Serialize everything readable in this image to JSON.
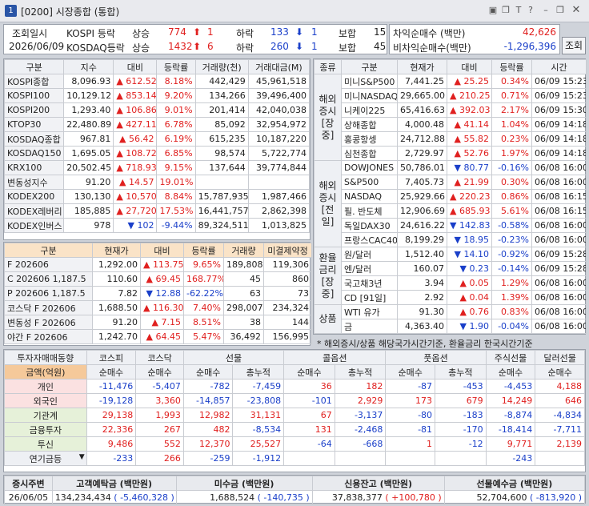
{
  "window": {
    "number": "1",
    "title": "[0200] 시장종합 (통합)"
  },
  "query": {
    "label": "조회일시",
    "date": "2026/06/09",
    "button": "조회"
  },
  "breadth": [
    {
      "market": "KOSPI 등락",
      "up_label": "상승",
      "up": "774",
      "limit_up": "1",
      "down_label": "하락",
      "down": "133",
      "limit_down": "1",
      "flat_label": "보합",
      "flat": "15"
    },
    {
      "market": "KOSDAQ등락",
      "up_label": "상승",
      "up": "1432",
      "limit_up": "6",
      "down_label": "하락",
      "down": "260",
      "limit_down": "1",
      "flat_label": "보합",
      "flat": "45"
    }
  ],
  "arb": [
    {
      "label": "차익순매수 (백만)",
      "value": "42,626"
    },
    {
      "label": "비차익순매수(백만)",
      "value": "-1,296,396"
    }
  ],
  "index_table": {
    "headers": [
      "구분",
      "지수",
      "대비",
      "등락률",
      "거래량(천)",
      "거래대금(M)"
    ],
    "rows": [
      {
        "name": "KOSPI종합",
        "v": "8,096.93",
        "chg": "612.52",
        "dir": "up",
        "rate": "8.18%",
        "vol": "442,429",
        "amt": "45,961,518"
      },
      {
        "name": "KOSPI100",
        "v": "10,129.12",
        "chg": "853.14",
        "dir": "up",
        "rate": "9.20%",
        "vol": "134,266",
        "amt": "39,496,400"
      },
      {
        "name": "KOSPI200",
        "v": "1,293.40",
        "chg": "106.86",
        "dir": "up",
        "rate": "9.01%",
        "vol": "201,414",
        "amt": "42,040,038"
      },
      {
        "name": "KTOP30",
        "v": "22,480.89",
        "chg": "427.11",
        "dir": "up",
        "rate": "6.78%",
        "vol": "85,092",
        "amt": "32,954,972"
      },
      {
        "name": "KOSDAQ종합",
        "v": "967.81",
        "chg": "56.42",
        "dir": "up",
        "rate": "6.19%",
        "vol": "615,235",
        "amt": "10,187,220"
      },
      {
        "name": "KOSDAQ150",
        "v": "1,695.05",
        "chg": "108.72",
        "dir": "up",
        "rate": "6.85%",
        "vol": "98,574",
        "amt": "5,722,774"
      },
      {
        "name": "KRX100",
        "v": "20,502.45",
        "chg": "718.93",
        "dir": "up",
        "rate": "9.15%",
        "vol": "137,644",
        "amt": "39,774,844"
      },
      {
        "name": "변동성지수",
        "v": "91.20",
        "chg": "14.57",
        "dir": "up",
        "rate": "19.01%",
        "vol": "",
        "amt": ""
      },
      {
        "name": "KODEX200",
        "v": "130,130",
        "chg": "10,570",
        "dir": "up",
        "rate": "8.84%",
        "vol": "15,787,935",
        "amt": "1,987,466"
      },
      {
        "name": "KODEX레버리",
        "v": "185,885",
        "chg": "27,720",
        "dir": "up",
        "rate": "17.53%",
        "vol": "16,441,757",
        "amt": "2,862,398"
      },
      {
        "name": "KODEX인버스",
        "v": "978",
        "chg": "102",
        "dir": "dn",
        "rate": "-9.44%",
        "vol": "89,324,511",
        "amt": "1,013,825"
      }
    ]
  },
  "futures_table": {
    "headers": [
      "구분",
      "현재가",
      "대비",
      "등락률",
      "거래량",
      "미결제약정"
    ],
    "rows": [
      {
        "name": "F 202606",
        "v": "1,292.00",
        "chg": "113.75",
        "dir": "up",
        "rate": "9.65%",
        "vol": "189,808",
        "oi": "119,306"
      },
      {
        "name": "C 202606 1,187.5",
        "v": "110.60",
        "chg": "69.45",
        "dir": "up",
        "rate": "168.77%",
        "vol": "45",
        "oi": "860"
      },
      {
        "name": "P 202606 1,187.5",
        "v": "7.82",
        "chg": "12.88",
        "dir": "dn",
        "rate": "-62.22%",
        "vol": "63",
        "oi": "73"
      },
      {
        "name": "코스닥 F 202606",
        "v": "1,688.50",
        "chg": "116.30",
        "dir": "up",
        "rate": "7.40%",
        "vol": "298,007",
        "oi": "234,324"
      },
      {
        "name": "변동성 F 202606",
        "v": "91.20",
        "chg": "7.15",
        "dir": "up",
        "rate": "8.51%",
        "vol": "38",
        "oi": "144"
      },
      {
        "name": "야간 F 202606",
        "v": "1,242.70",
        "chg": "64.45",
        "dir": "up",
        "rate": "5.47%",
        "vol": "36,492",
        "oi": "156,995"
      }
    ]
  },
  "overseas_table": {
    "headers": [
      "종류",
      "구분",
      "현재가",
      "대비",
      "등락률",
      "시간"
    ],
    "groups": [
      {
        "label": "해외\n증시\n[장중]",
        "rows": [
          {
            "name": "미니S&P500",
            "v": "7,441.25",
            "chg": "25.25",
            "dir": "up",
            "rate": "0.34%",
            "time": "06/09 15:23"
          },
          {
            "name": "미니NASDAQ",
            "v": "29,665.00",
            "chg": "210.25",
            "dir": "up",
            "rate": "0.71%",
            "time": "06/09 15:23"
          },
          {
            "name": "니케이225",
            "v": "65,416.63",
            "chg": "392.03",
            "dir": "up",
            "rate": "2.17%",
            "time": "06/09 15:30"
          },
          {
            "name": "상해종합",
            "v": "4,000.48",
            "chg": "41.14",
            "dir": "up",
            "rate": "1.04%",
            "time": "06/09 14:18"
          },
          {
            "name": "홍콩항셍",
            "v": "24,712.88",
            "chg": "55.82",
            "dir": "up",
            "rate": "0.23%",
            "time": "06/09 14:18"
          },
          {
            "name": "심천종합",
            "v": "2,729.97",
            "chg": "52.76",
            "dir": "up",
            "rate": "1.97%",
            "time": "06/09 14:18"
          }
        ]
      },
      {
        "label": "해외\n증시\n[전일]",
        "rows": [
          {
            "name": "DOWJONES",
            "v": "50,786.01",
            "chg": "80.77",
            "dir": "dn",
            "rate": "-0.16%",
            "time": "06/08 16:00"
          },
          {
            "name": "S&P500",
            "v": "7,405.73",
            "chg": "21.99",
            "dir": "up",
            "rate": "0.30%",
            "time": "06/08 16:00"
          },
          {
            "name": "NASDAQ",
            "v": "25,929.66",
            "chg": "220.23",
            "dir": "up",
            "rate": "0.86%",
            "time": "06/08 16:15"
          },
          {
            "name": "필. 반도체",
            "v": "12,906.69",
            "chg": "685.93",
            "dir": "up",
            "rate": "5.61%",
            "time": "06/08 16:15"
          },
          {
            "name": "독일DAX30",
            "v": "24,616.22",
            "chg": "142.83",
            "dir": "dn",
            "rate": "-0.58%",
            "time": "06/08 16:00"
          },
          {
            "name": "프랑스CAC40",
            "v": "8,199.29",
            "chg": "18.95",
            "dir": "dn",
            "rate": "-0.23%",
            "time": "06/08 16:00"
          }
        ]
      },
      {
        "label": "환율\n금리\n[장중]",
        "rows": [
          {
            "name": "원/달러",
            "v": "1,512.40",
            "chg": "14.10",
            "dir": "dn",
            "rate": "-0.92%",
            "time": "06/09 15:28"
          },
          {
            "name": "엔/달러",
            "v": "160.07",
            "chg": "0.23",
            "dir": "dn",
            "rate": "-0.14%",
            "time": "06/09 15:28"
          },
          {
            "name": "국고채3년",
            "v": "3.94",
            "chg": "0.05",
            "dir": "up",
            "rate": "1.29%",
            "time": "06/08 16:00"
          },
          {
            "name": "CD [91일]",
            "v": "2.92",
            "chg": "0.04",
            "dir": "up",
            "rate": "1.39%",
            "time": "06/08 16:00"
          }
        ]
      },
      {
        "label": "상품",
        "rows": [
          {
            "name": "WTI 유가",
            "v": "91.30",
            "chg": "0.76",
            "dir": "up",
            "rate": "0.83%",
            "time": "06/08 16:00"
          },
          {
            "name": "금",
            "v": "4,363.40",
            "chg": "1.90",
            "dir": "dn",
            "rate": "-0.04%",
            "time": "06/08 16:00"
          }
        ]
      }
    ]
  },
  "note": "* 해외증시/상품 해당국가시간기준, 환율금리 한국시간기준",
  "investor": {
    "groups": [
      "투자자매매동향",
      "코스피",
      "코스닥",
      "선물",
      "콜옵션",
      "풋옵션",
      "주식선물",
      "달러선물"
    ],
    "sub": [
      "금액(억원)",
      "순매수",
      "순매수",
      "순매수",
      "총누적",
      "순매수",
      "총누적",
      "순매수",
      "총누적",
      "순매수",
      "순매수"
    ],
    "rows": [
      {
        "name": "개인",
        "v": [
          "-11,476",
          "-5,407",
          "-782",
          "-7,459",
          "36",
          "182",
          "-87",
          "-453",
          "-4,453",
          "4,188"
        ]
      },
      {
        "name": "외국인",
        "v": [
          "-19,128",
          "3,360",
          "-14,857",
          "-23,808",
          "-101",
          "2,929",
          "173",
          "679",
          "14,249",
          "646"
        ]
      },
      {
        "name": "기관계",
        "v": [
          "29,138",
          "1,993",
          "12,982",
          "31,131",
          "67",
          "-3,137",
          "-80",
          "-183",
          "-8,874",
          "-4,834"
        ]
      },
      {
        "name": "금융투자",
        "v": [
          "22,336",
          "267",
          "482",
          "-8,534",
          "131",
          "-2,468",
          "-81",
          "-170",
          "-18,414",
          "-7,711"
        ]
      },
      {
        "name": "투신",
        "v": [
          "9,486",
          "552",
          "12,370",
          "25,527",
          "-64",
          "-668",
          "1",
          "-12",
          "9,771",
          "2,139"
        ]
      },
      {
        "name": "연기금등",
        "v": [
          "-233",
          "266",
          "-259",
          "-1,912",
          "",
          "",
          "",
          "",
          "-243",
          ""
        ]
      }
    ]
  },
  "footer": {
    "headers": [
      "증시주변",
      "고객예탁금 (백만원)",
      "미수금 (백만원)",
      "신용잔고 (백만원)",
      "선물예수금 (백만원)"
    ],
    "date": "26/06/05",
    "deposit": "134,234,434",
    "deposit_chg": "-5,460,328",
    "unpaid": "1,688,524",
    "unpaid_chg": "-140,735",
    "credit": "37,838,377",
    "credit_chg": "+100,780",
    "fut": "52,704,600",
    "fut_chg": "-813,920"
  },
  "colors": {
    "up": "#e0201f",
    "down": "#1a3fc9",
    "futures_header": "#fae3c7",
    "investor_label": "#fae3c7",
    "foreign_label": "#fbe1e1",
    "inst_label": "#e6f1d9"
  }
}
